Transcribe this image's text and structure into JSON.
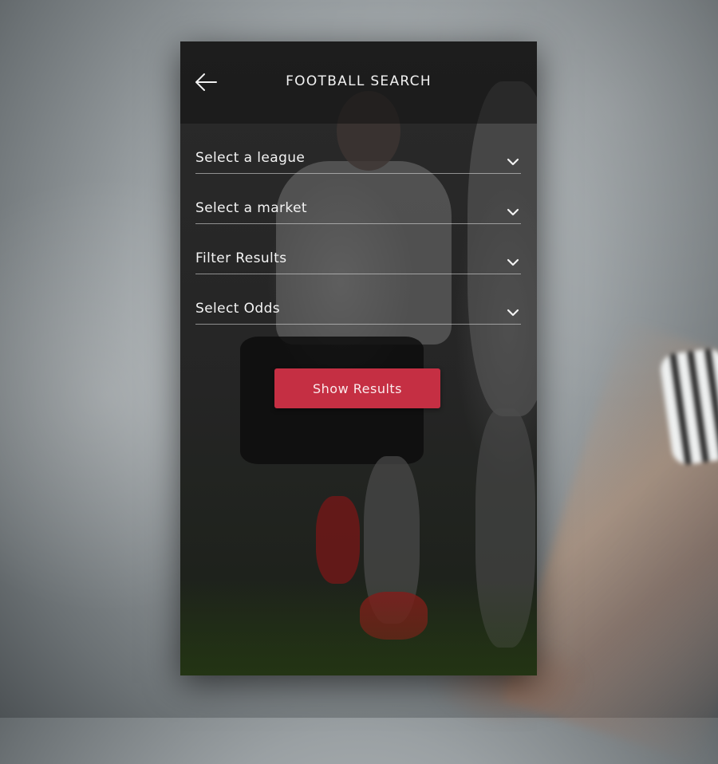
{
  "header": {
    "title": "FOOTBALL SEARCH",
    "back_icon": "arrow-left-icon"
  },
  "filters": [
    {
      "label": "Select a league",
      "icon": "chevron-down-icon"
    },
    {
      "label": "Select a market",
      "icon": "chevron-down-icon"
    },
    {
      "label": "Filter Results",
      "icon": "chevron-down-icon"
    },
    {
      "label": "Select Odds",
      "icon": "chevron-down-icon"
    }
  ],
  "actions": {
    "show_results_label": "Show Results"
  },
  "colors": {
    "accent": "#c52f43",
    "text": "#f4f4f4",
    "divider": "#e6e6e6"
  }
}
